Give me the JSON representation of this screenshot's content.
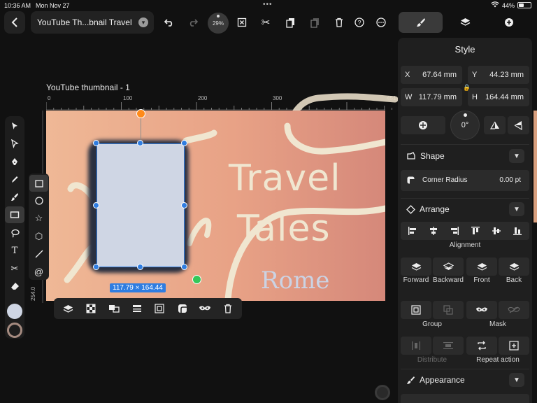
{
  "status": {
    "time": "10:36 AM",
    "date": "Mon Nov 27",
    "battery": "44%",
    "battery_level": 0.44
  },
  "toolbar": {
    "back_icon": "chevron-left-icon",
    "doc_title": "YouTube Th...bnail Travel",
    "zoom": "29%"
  },
  "panel_tabs": [
    "style-tab",
    "layers-tab",
    "add-tab"
  ],
  "canvas": {
    "artboard_name": "YouTube thumbnail - 1",
    "ruler_h": [
      "0",
      "100",
      "200",
      "300",
      "451"
    ],
    "ruler_v": "254.0",
    "text_travel": "Travel",
    "text_tales": "Tales",
    "text_rome": "Rome",
    "selection_size": "117.79 × 164.44",
    "colors": {
      "artboard_start": "#efb896",
      "artboard_end": "#d5887a",
      "selection": "#2f7de1",
      "text": "#f0e6d0"
    }
  },
  "style_panel": {
    "title": "Style",
    "x_label": "X",
    "x_value": "67.64 mm",
    "y_label": "Y",
    "y_value": "44.23 mm",
    "w_label": "W",
    "w_value": "117.79 mm",
    "h_label": "H",
    "h_value": "164.44 mm",
    "rotation": "0°",
    "shape_title": "Shape",
    "corner_radius_label": "Corner Radius",
    "corner_radius_value": "0.00 pt",
    "arrange_title": "Arrange",
    "alignment_label": "Alignment",
    "order_buttons": [
      "Forward",
      "Backward",
      "Front",
      "Back"
    ],
    "group_label": "Group",
    "mask_label": "Mask",
    "distribute_label": "Distribute",
    "repeat_label": "Repeat action",
    "appearance_title": "Appearance"
  }
}
